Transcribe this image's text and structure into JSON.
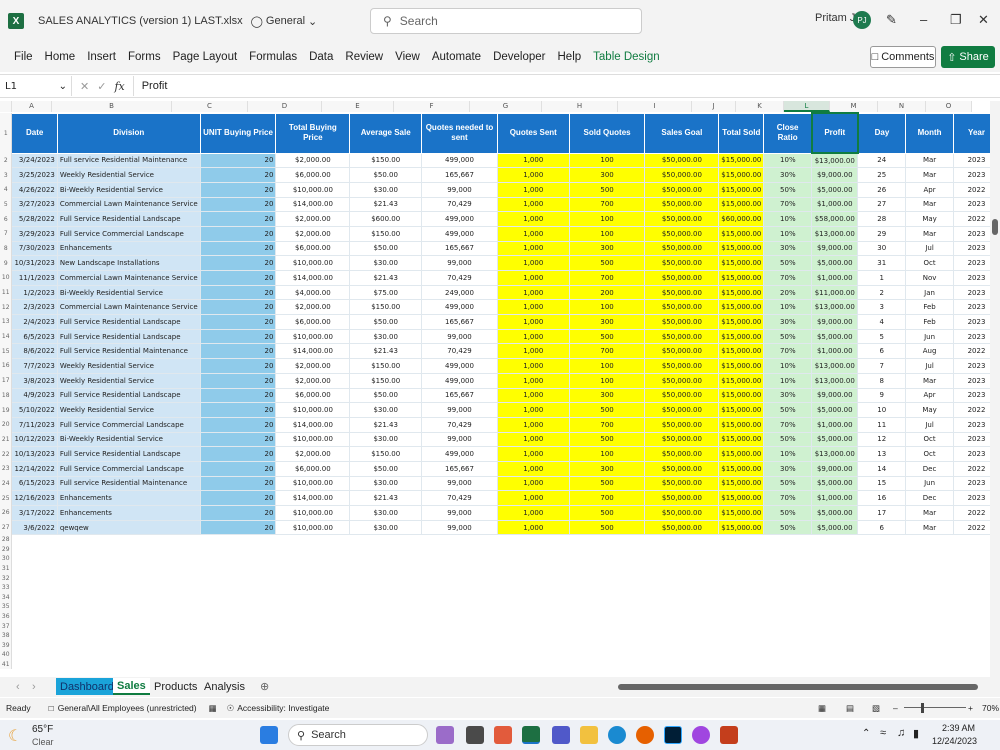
{
  "titlebar": {
    "app_icon": "X",
    "doc_title": "SALES ANALYTICS (version 1) LAST.xlsx",
    "sensitivity": "General",
    "search_placeholder": "Search",
    "user": "Pritam JR",
    "user_initials": "PJ"
  },
  "menu": [
    "File",
    "Home",
    "Insert",
    "Forms",
    "Page Layout",
    "Formulas",
    "Data",
    "Review",
    "View",
    "Automate",
    "Developer",
    "Help",
    "Table Design"
  ],
  "buttons": {
    "comments": "Comments",
    "share": "Share"
  },
  "formula_bar": {
    "name_box": "L1",
    "fx": "fx",
    "value": "Profit"
  },
  "col_letters": [
    "A",
    "B",
    "C",
    "D",
    "E",
    "F",
    "G",
    "H",
    "I",
    "J",
    "K",
    "L",
    "M",
    "N",
    "O"
  ],
  "headers": [
    "Date",
    "Division",
    "UNIT Buying Price",
    "Total Buying Price",
    "Average Sale",
    "Quotes needed to sent",
    "Quotes Sent",
    "Sold Quotes",
    "Sales Goal",
    "Total Sold",
    "Close Ratio",
    "Profit",
    "Day",
    "Month",
    "Year"
  ],
  "rows": [
    [
      "3/24/2023",
      "Full service Residential Maintenance",
      "20",
      "$2,000.00",
      "$150.00",
      "499,000",
      "1,000",
      "100",
      "$50,000.00",
      "$15,000.00",
      "10%",
      "$13,000.00",
      "24",
      "Mar",
      "2023"
    ],
    [
      "3/25/2023",
      "Weekly Residential Service",
      "20",
      "$6,000.00",
      "$50.00",
      "165,667",
      "1,000",
      "300",
      "$50,000.00",
      "$15,000.00",
      "30%",
      "$9,000.00",
      "25",
      "Mar",
      "2023"
    ],
    [
      "4/26/2022",
      "Bi-Weekly Residential Service",
      "20",
      "$10,000.00",
      "$30.00",
      "99,000",
      "1,000",
      "500",
      "$50,000.00",
      "$15,000.00",
      "50%",
      "$5,000.00",
      "26",
      "Apr",
      "2022"
    ],
    [
      "3/27/2023",
      "Commercial Lawn Maintenance Service",
      "20",
      "$14,000.00",
      "$21.43",
      "70,429",
      "1,000",
      "700",
      "$50,000.00",
      "$15,000.00",
      "70%",
      "$1,000.00",
      "27",
      "Mar",
      "2023"
    ],
    [
      "5/28/2022",
      "Full Service Residential Landscape",
      "20",
      "$2,000.00",
      "$600.00",
      "499,000",
      "1,000",
      "100",
      "$50,000.00",
      "$60,000.00",
      "10%",
      "$58,000.00",
      "28",
      "May",
      "2022"
    ],
    [
      "3/29/2023",
      "Full Service Commercial Landscape",
      "20",
      "$2,000.00",
      "$150.00",
      "499,000",
      "1,000",
      "100",
      "$50,000.00",
      "$15,000.00",
      "10%",
      "$13,000.00",
      "29",
      "Mar",
      "2023"
    ],
    [
      "7/30/2023",
      "Enhancements",
      "20",
      "$6,000.00",
      "$50.00",
      "165,667",
      "1,000",
      "300",
      "$50,000.00",
      "$15,000.00",
      "30%",
      "$9,000.00",
      "30",
      "Jul",
      "2023"
    ],
    [
      "10/31/2023",
      "New Landscape Installations",
      "20",
      "$10,000.00",
      "$30.00",
      "99,000",
      "1,000",
      "500",
      "$50,000.00",
      "$15,000.00",
      "50%",
      "$5,000.00",
      "31",
      "Oct",
      "2023"
    ],
    [
      "11/1/2023",
      "Commercial Lawn Maintenance Service",
      "20",
      "$14,000.00",
      "$21.43",
      "70,429",
      "1,000",
      "700",
      "$50,000.00",
      "$15,000.00",
      "70%",
      "$1,000.00",
      "1",
      "Nov",
      "2023"
    ],
    [
      "1/2/2023",
      "Bi-Weekly Residential Service",
      "20",
      "$4,000.00",
      "$75.00",
      "249,000",
      "1,000",
      "200",
      "$50,000.00",
      "$15,000.00",
      "20%",
      "$11,000.00",
      "2",
      "Jan",
      "2023"
    ],
    [
      "2/3/2023",
      "Commercial Lawn Maintenance Service",
      "20",
      "$2,000.00",
      "$150.00",
      "499,000",
      "1,000",
      "100",
      "$50,000.00",
      "$15,000.00",
      "10%",
      "$13,000.00",
      "3",
      "Feb",
      "2023"
    ],
    [
      "2/4/2023",
      "Full Service Residential Landscape",
      "20",
      "$6,000.00",
      "$50.00",
      "165,667",
      "1,000",
      "300",
      "$50,000.00",
      "$15,000.00",
      "30%",
      "$9,000.00",
      "4",
      "Feb",
      "2023"
    ],
    [
      "6/5/2023",
      "Full Service Residential Landscape",
      "20",
      "$10,000.00",
      "$30.00",
      "99,000",
      "1,000",
      "500",
      "$50,000.00",
      "$15,000.00",
      "50%",
      "$5,000.00",
      "5",
      "Jun",
      "2023"
    ],
    [
      "8/6/2022",
      "Full Service Residential Maintenance",
      "20",
      "$14,000.00",
      "$21.43",
      "70,429",
      "1,000",
      "700",
      "$50,000.00",
      "$15,000.00",
      "70%",
      "$1,000.00",
      "6",
      "Aug",
      "2022"
    ],
    [
      "7/7/2023",
      "Weekly Residential Service",
      "20",
      "$2,000.00",
      "$150.00",
      "499,000",
      "1,000",
      "100",
      "$50,000.00",
      "$15,000.00",
      "10%",
      "$13,000.00",
      "7",
      "Jul",
      "2023"
    ],
    [
      "3/8/2023",
      "Weekly Residential Service",
      "20",
      "$2,000.00",
      "$150.00",
      "499,000",
      "1,000",
      "100",
      "$50,000.00",
      "$15,000.00",
      "10%",
      "$13,000.00",
      "8",
      "Mar",
      "2023"
    ],
    [
      "4/9/2023",
      "Full Service Residential Landscape",
      "20",
      "$6,000.00",
      "$50.00",
      "165,667",
      "1,000",
      "300",
      "$50,000.00",
      "$15,000.00",
      "30%",
      "$9,000.00",
      "9",
      "Apr",
      "2023"
    ],
    [
      "5/10/2022",
      "Weekly Residential Service",
      "20",
      "$10,000.00",
      "$30.00",
      "99,000",
      "1,000",
      "500",
      "$50,000.00",
      "$15,000.00",
      "50%",
      "$5,000.00",
      "10",
      "May",
      "2022"
    ],
    [
      "7/11/2023",
      "Full Service Commercial Landscape",
      "20",
      "$14,000.00",
      "$21.43",
      "70,429",
      "1,000",
      "700",
      "$50,000.00",
      "$15,000.00",
      "70%",
      "$1,000.00",
      "11",
      "Jul",
      "2023"
    ],
    [
      "10/12/2023",
      "Bi-Weekly Residential Service",
      "20",
      "$10,000.00",
      "$30.00",
      "99,000",
      "1,000",
      "500",
      "$50,000.00",
      "$15,000.00",
      "50%",
      "$5,000.00",
      "12",
      "Oct",
      "2023"
    ],
    [
      "10/13/2023",
      "Full Service Residential Landscape",
      "20",
      "$2,000.00",
      "$150.00",
      "499,000",
      "1,000",
      "100",
      "$50,000.00",
      "$15,000.00",
      "10%",
      "$13,000.00",
      "13",
      "Oct",
      "2023"
    ],
    [
      "12/14/2022",
      "Full Service Commercial Landscape",
      "20",
      "$6,000.00",
      "$50.00",
      "165,667",
      "1,000",
      "300",
      "$50,000.00",
      "$15,000.00",
      "30%",
      "$9,000.00",
      "14",
      "Dec",
      "2022"
    ],
    [
      "6/15/2023",
      "Full service Residential Maintenance",
      "20",
      "$10,000.00",
      "$30.00",
      "99,000",
      "1,000",
      "500",
      "$50,000.00",
      "$15,000.00",
      "50%",
      "$5,000.00",
      "15",
      "Jun",
      "2023"
    ],
    [
      "12/16/2023",
      "Enhancements",
      "20",
      "$14,000.00",
      "$21.43",
      "70,429",
      "1,000",
      "700",
      "$50,000.00",
      "$15,000.00",
      "70%",
      "$1,000.00",
      "16",
      "Dec",
      "2023"
    ],
    [
      "3/17/2022",
      "Enhancements",
      "20",
      "$10,000.00",
      "$30.00",
      "99,000",
      "1,000",
      "500",
      "$50,000.00",
      "$15,000.00",
      "50%",
      "$5,000.00",
      "17",
      "Mar",
      "2022"
    ],
    [
      "3/6/2022",
      "qewqew",
      "20",
      "$10,000.00",
      "$30.00",
      "99,000",
      "1,000",
      "500",
      "$50,000.00",
      "$15,000.00",
      "50%",
      "$5,000.00",
      "6",
      "Mar",
      "2022"
    ]
  ],
  "empty_rows": [
    "28",
    "29",
    "30",
    "31",
    "32",
    "33",
    "34",
    "35",
    "36",
    "37",
    "38",
    "39",
    "40",
    "41"
  ],
  "sheet_tabs": [
    "Dashboard",
    "Sales",
    "Products",
    "Analysis"
  ],
  "active_tab": "Sales",
  "status": {
    "ready": "Ready",
    "label": "General\\All Employees (unrestricted)",
    "accessibility": "Accessibility: Investigate",
    "zoom": "70%"
  },
  "taskbar": {
    "temp": "65°F",
    "weather": "Clear",
    "search": "Search",
    "time": "2:39 AM",
    "date": "12/24/2023"
  }
}
